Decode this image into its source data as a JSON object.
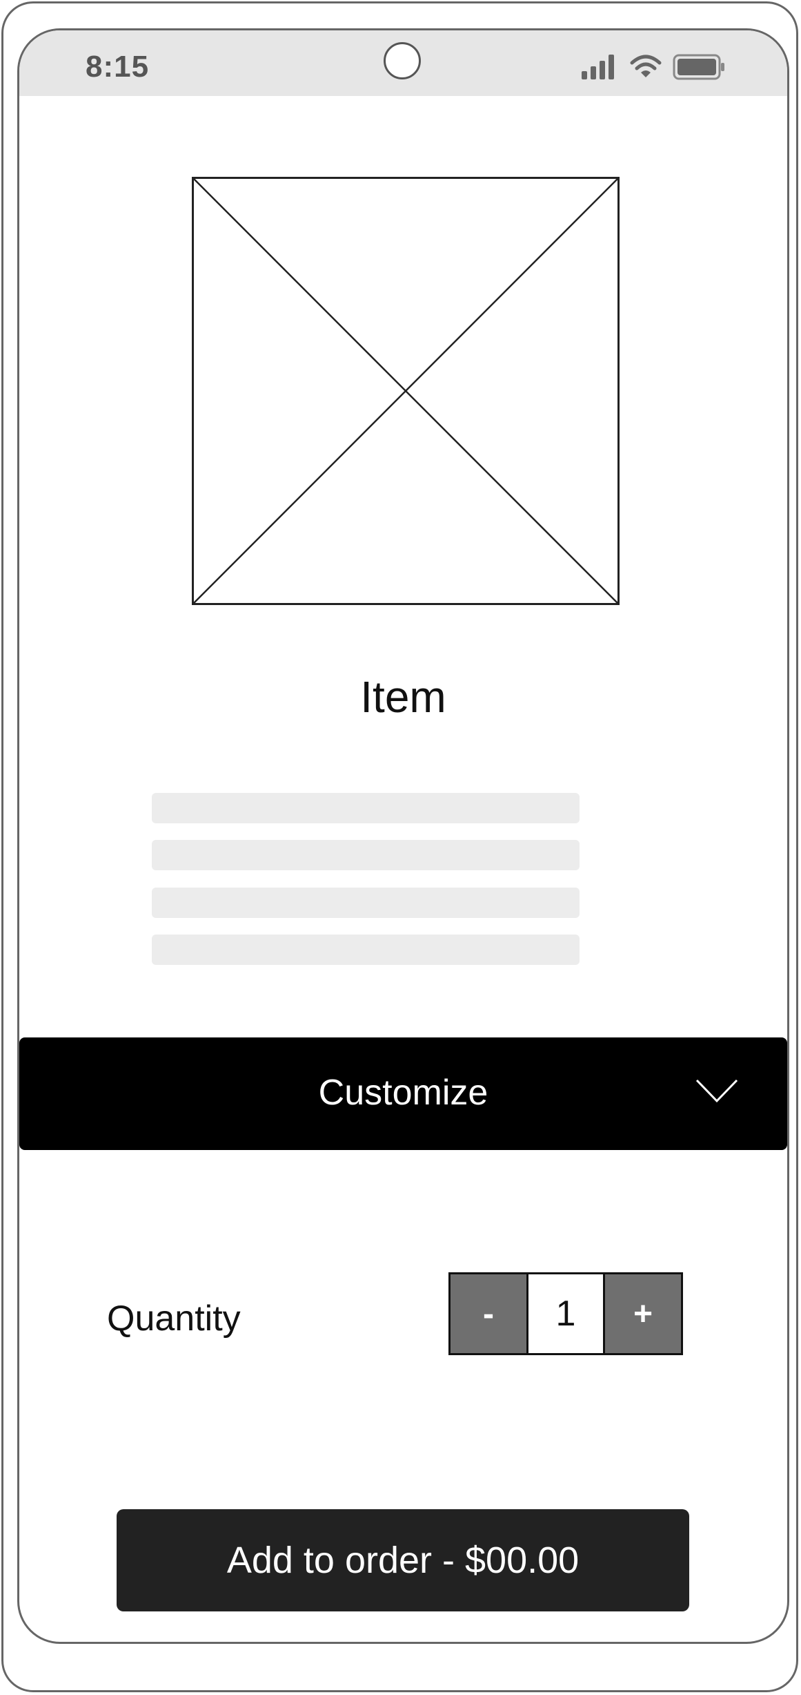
{
  "status_bar": {
    "time": "8:15",
    "icons": [
      "signal-icon",
      "wifi-icon",
      "battery-icon"
    ]
  },
  "product": {
    "image_icon": "image-placeholder-icon",
    "title": "Item"
  },
  "customize": {
    "label": "Customize",
    "icon": "chevron-down-icon"
  },
  "quantity": {
    "label": "Quantity",
    "decrement_label": "-",
    "value": "1",
    "increment_label": "+"
  },
  "add_button": {
    "label": "Add to order - $00.00"
  },
  "colors": {
    "status_bar_bg": "#e6e6e6",
    "customize_bg": "#000000",
    "stepper_button_bg": "#6f6f6f",
    "add_button_bg": "#222222",
    "placeholder_text_bg": "#ececec"
  }
}
